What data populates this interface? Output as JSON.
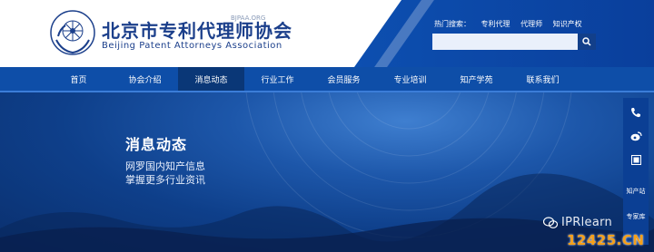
{
  "header": {
    "title": "北京市专利代理师协会",
    "subtitle": "Beijing Patent Attorneys Association",
    "domain": "BJPAA.ORG",
    "hot_search_label": "热门搜索：",
    "hot_search_terms": [
      "专利代理",
      "代理师",
      "知识产权"
    ],
    "search_placeholder": ""
  },
  "nav": {
    "items": [
      "首页",
      "协会介绍",
      "消息动态",
      "行业工作",
      "会员服务",
      "专业培训",
      "知产学苑",
      "联系我们"
    ],
    "active": "消息动态"
  },
  "banner": {
    "title": "消息动态",
    "line1": "网罗国内知产信息",
    "line2": "掌握更多行业资讯"
  },
  "sidebar": {
    "items": [
      "phone-icon",
      "weibo-icon",
      "qrcode-icon"
    ],
    "labels": [
      "知产站",
      "专家库"
    ]
  },
  "watermark": {
    "wechat_text": "IPRlearn",
    "site": "12425.CN"
  },
  "colors": {
    "brand": "#1b3f8b",
    "nav": "#0e4ea8",
    "nav_active": "#0a3777",
    "watermark": "#f5a01a"
  }
}
